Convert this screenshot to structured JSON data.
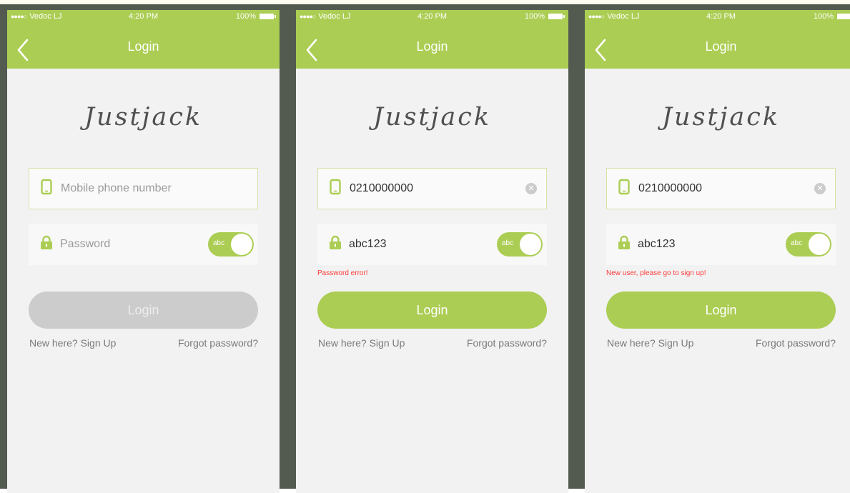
{
  "colors": {
    "accent": "#abcd53",
    "error": "#ff3b3b",
    "disabled_button": "#cccccc",
    "background": "#535b51",
    "screen": "#f2f2f2"
  },
  "icons": {
    "back": "chevron-left-icon",
    "phone": "mobile-phone-icon",
    "lock": "lock-icon",
    "clear": "clear-icon",
    "battery": "battery-icon"
  },
  "screens": [
    {
      "status": {
        "carrier": "Vedoc LJ",
        "time": "4:20 PM",
        "battery": "100%"
      },
      "nav_title": "Login",
      "logo": "Justjack",
      "phone_field": {
        "value": "",
        "placeholder": "Mobile phone number"
      },
      "password_field": {
        "value": "",
        "placeholder": "Password"
      },
      "toggle_label": "abc",
      "error": "",
      "login_label": "Login",
      "login_enabled": false,
      "signup_label": "New here? Sign Up",
      "forgot_label": "Forgot password?"
    },
    {
      "status": {
        "carrier": "Vedoc LJ",
        "time": "4:20 PM",
        "battery": "100%"
      },
      "nav_title": "Login",
      "logo": "Justjack",
      "phone_field": {
        "value": "0210000000",
        "placeholder": "Mobile phone number"
      },
      "password_field": {
        "value": "abc123",
        "placeholder": "Password"
      },
      "toggle_label": "abc",
      "error": "Password error!",
      "login_label": "Login",
      "login_enabled": true,
      "signup_label": "New here? Sign Up",
      "forgot_label": "Forgot password?"
    },
    {
      "status": {
        "carrier": "Vedoc LJ",
        "time": "4:20 PM",
        "battery": "100%"
      },
      "nav_title": "Login",
      "logo": "Justjack",
      "phone_field": {
        "value": "0210000000",
        "placeholder": "Mobile phone number"
      },
      "password_field": {
        "value": "abc123",
        "placeholder": "Password"
      },
      "toggle_label": "abc",
      "error": "New user, please go to sign up!",
      "login_label": "Login",
      "login_enabled": true,
      "signup_label": "New here? Sign Up",
      "forgot_label": "Forgot password?"
    }
  ]
}
